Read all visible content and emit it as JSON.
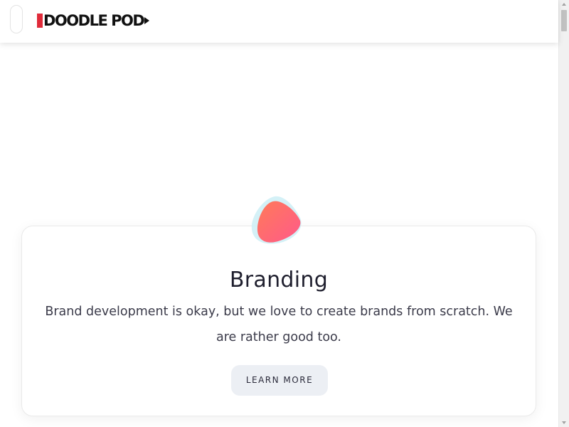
{
  "header": {
    "logo_text": "DOODLE POD"
  },
  "service_card": {
    "title": "Branding",
    "description": "Brand development is okay, but we love to create brands from scratch. We are rather good too.",
    "button_label": "LEARN MORE"
  },
  "colors": {
    "blob_gradient_start": "#ff7a59",
    "blob_gradient_end": "#ff5a8a",
    "blob_shadow": "#bfeaf4",
    "logo_accent": "#e02b3a",
    "button_bg": "#eceff4"
  },
  "icons": {
    "menu_toggle": "menu-toggle-icon",
    "service_icon": "blob-icon"
  }
}
